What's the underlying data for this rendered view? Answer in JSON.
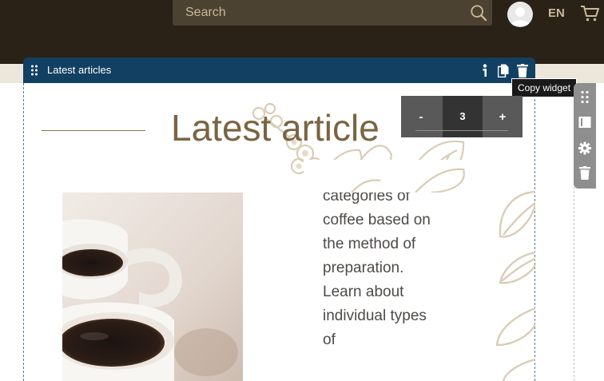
{
  "header": {
    "search": {
      "placeholder": "Search",
      "value": ""
    },
    "language": "EN",
    "icons": {
      "search": "search-icon",
      "profile": "user-avatar-icon",
      "cart": "cart-icon"
    }
  },
  "widget_toolbar": {
    "title": "Latest articles",
    "icons": [
      "drag-handle-icon",
      "info-icon",
      "copy-icon",
      "trash-icon"
    ],
    "tooltip": "Copy widget"
  },
  "side_panel": {
    "icons": [
      "drag-handle-icon",
      "layout-icon",
      "gear-icon",
      "trash-icon"
    ]
  },
  "stepper": {
    "minus": "-",
    "value": "3",
    "plus": "+"
  },
  "section": {
    "heading": "Latest article",
    "article_text": "categories of coffee based on the method of preparation. Learn about individual types of"
  },
  "colors": {
    "header_bg": "#2a2117",
    "toolbar_bg": "#124062",
    "heading": "#7a6442",
    "decor": "#d9cdb5"
  }
}
